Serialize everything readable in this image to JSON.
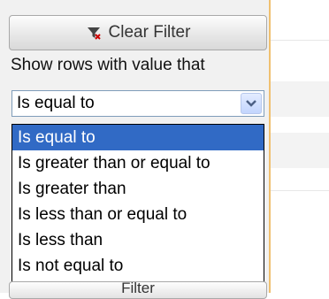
{
  "filter_popup": {
    "clear_button_label": "Clear Filter",
    "clear_icon": "clear-filter-icon",
    "instruction_label": "Show rows with value that",
    "operator_select": {
      "selected_value": "Is equal to",
      "options": [
        "Is equal to",
        "Is greater than or equal to",
        "Is greater than",
        "Is less than or equal to",
        "Is less than",
        "Is not equal to"
      ],
      "highlighted_index": 0
    },
    "filter_button_label": "Filter"
  },
  "colors": {
    "highlight": "#316ac5",
    "popup_border": "#f0c070",
    "popup_background": "#f1f1f1"
  }
}
